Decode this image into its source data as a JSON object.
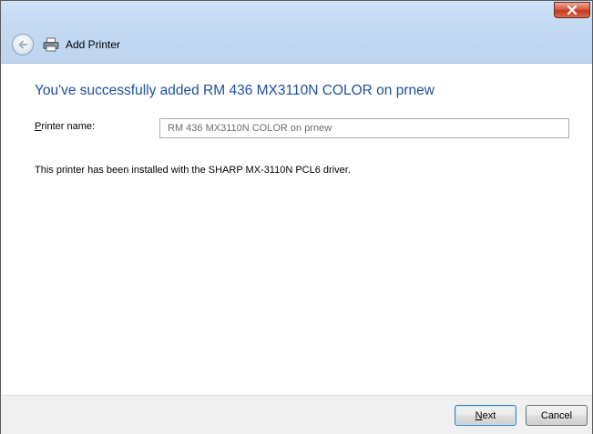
{
  "window": {
    "title": "Add Printer"
  },
  "main": {
    "heading": "You've successfully added RM 436  MX3110N COLOR on prnew",
    "printer_name": {
      "label_accel": "P",
      "label_rest": "rinter name:",
      "value": "RM 436  MX3110N COLOR on prnew"
    },
    "info": "This printer has been installed with the SHARP MX-3110N PCL6 driver."
  },
  "footer": {
    "next_accel": "N",
    "next_rest": "ext",
    "cancel_label": "Cancel"
  },
  "icons": {
    "close": "close-icon",
    "back": "back-arrow-icon",
    "printer": "printer-icon"
  },
  "colors": {
    "heading": "#1e4f9c",
    "titlebar": "#c4daf2",
    "close_button": "#c23a20",
    "footer": "#f0f0f0"
  }
}
